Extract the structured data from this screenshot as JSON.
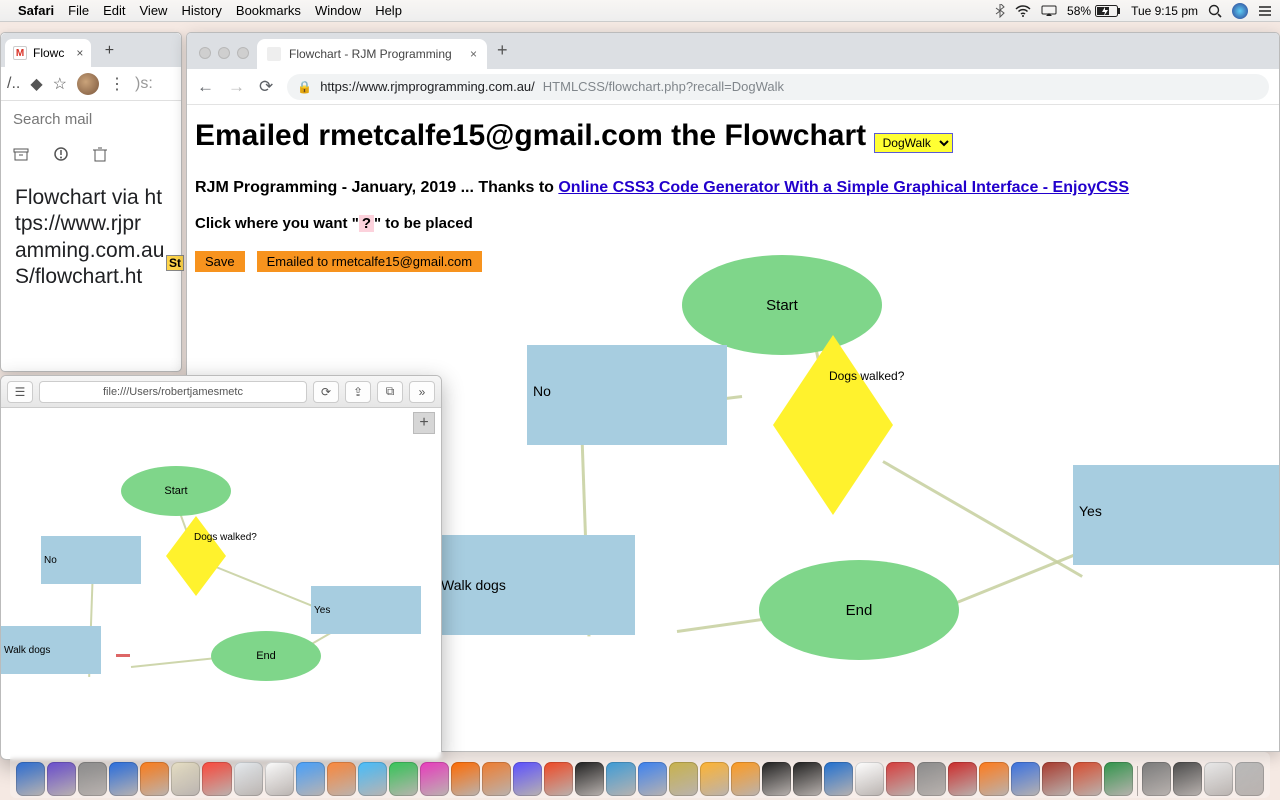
{
  "menubar": {
    "app": "Safari",
    "items": [
      "File",
      "Edit",
      "View",
      "History",
      "Bookmarks",
      "Window",
      "Help"
    ],
    "battery_pct": "58%",
    "clock": "Tue 9:15 pm"
  },
  "back_window": {
    "tab_title": "Flowc",
    "search_placeholder": "Search mail",
    "subject": "Flowchart via https://www.rjprogramming.com.au/HTMLCSS/flowchart.html"
  },
  "st_badge": "St",
  "main_window": {
    "tab_title": "Flowchart - RJM Programming",
    "url_host": "https://www.rjmprogramming.com.au/",
    "url_path": "HTMLCSS/flowchart.php?recall=DogWalk",
    "heading": "Emailed rmetcalfe15@gmail.com the Flowchart",
    "select_value": "DogWalk",
    "subline_prefix": "RJM Programming - January, 2019 ... Thanks to ",
    "subline_link": "Online CSS3 Code Generator With a Simple Graphical Interface - EnjoyCSS",
    "clickline_a": "Click where you want \"",
    "clickline_q": "?",
    "clickline_b": "\" to be placed",
    "btn_save": "Save",
    "btn_emailed": "Emailed to rmetcalfe15@gmail.com"
  },
  "safari_window": {
    "url": "file:///Users/robertjamesmetc"
  },
  "flow": {
    "start": "Start",
    "decision": "Dogs walked?",
    "no": "No",
    "yes": "Yes",
    "walk": "Walk dogs",
    "end": "End"
  },
  "dock_colors": [
    "#2e6fd4",
    "#6b4ed0",
    "#8e8e8e",
    "#2a6fe0",
    "#ff7e1b",
    "#e9e1c6",
    "#ff4a3d",
    "#e9eef2",
    "#ffffff",
    "#4aa3ff",
    "#ff8a3d",
    "#49c0ff",
    "#37c85a",
    "#ec3dc0",
    "#ff6a00",
    "#ef7c2e",
    "#5a4fff",
    "#ef4723",
    "#1f1f1f",
    "#3c9bd6",
    "#3b81f0",
    "#c8b24a",
    "#ffb330",
    "#ff9a1e",
    "#1f1f1f",
    "#1f1f1f",
    "#1f6fd0",
    "#ffffff",
    "#d63c3c",
    "#8b8b8b",
    "#cc2a2a",
    "#ff7a1a",
    "#3870e0",
    "#a8392d",
    "#d64b2e",
    "#2f944a",
    "#7a7a7a",
    "#4a4a4a",
    "#e9e9e9",
    "#b9b9b9"
  ]
}
